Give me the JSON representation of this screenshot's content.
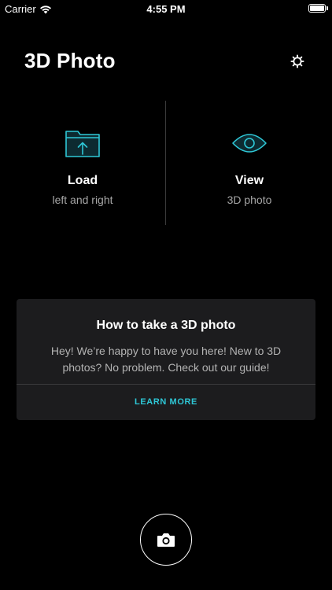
{
  "status_bar": {
    "carrier": "Carrier",
    "time": "4:55 PM"
  },
  "header": {
    "title": "3D Photo"
  },
  "actions": {
    "load": {
      "label": "Load",
      "sub": "left and right",
      "icon": "folder-upload-icon"
    },
    "view": {
      "label": "View",
      "sub": "3D photo",
      "icon": "eye-icon"
    }
  },
  "guide": {
    "title": "How to take a 3D photo",
    "body": "Hey! We’re happy to have you here! New to 3D photos? No problem. Check out our guide!",
    "link": "LEARN MORE"
  },
  "colors": {
    "accent": "#2ec7d6",
    "background": "#000000",
    "card": "#1c1c1e"
  }
}
